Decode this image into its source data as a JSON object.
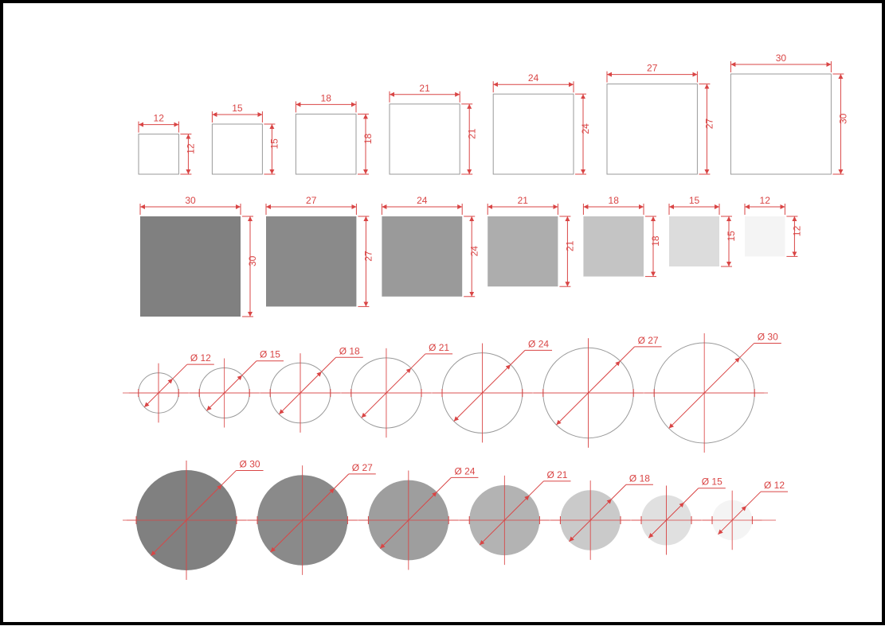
{
  "row1": {
    "description": "outlined squares ascending, dimension above and right",
    "squares": [
      {
        "size": 12
      },
      {
        "size": 15
      },
      {
        "size": 18
      },
      {
        "size": 21
      },
      {
        "size": 24
      },
      {
        "size": 27
      },
      {
        "size": 30
      }
    ]
  },
  "row2": {
    "description": "filled gray squares descending, dimension above and right",
    "squares": [
      {
        "size": 30,
        "fill": "#808080"
      },
      {
        "size": 27,
        "fill": "#8a8a8a"
      },
      {
        "size": 24,
        "fill": "#9a9a9a"
      },
      {
        "size": 21,
        "fill": "#adadad"
      },
      {
        "size": 18,
        "fill": "#c4c4c4"
      },
      {
        "size": 15,
        "fill": "#dcdcdc"
      },
      {
        "size": 12,
        "fill": "#f4f4f4"
      }
    ]
  },
  "row3": {
    "description": "outlined circles ascending with diameter leader",
    "circles": [
      {
        "dia": 12
      },
      {
        "dia": 15
      },
      {
        "dia": 18
      },
      {
        "dia": 21
      },
      {
        "dia": 24
      },
      {
        "dia": 27
      },
      {
        "dia": 30
      }
    ],
    "prefix": "Ø"
  },
  "row4": {
    "description": "filled gray circles descending with diameter leader",
    "circles": [
      {
        "dia": 30,
        "fill": "#808080"
      },
      {
        "dia": 27,
        "fill": "#8a8a8a"
      },
      {
        "dia": 24,
        "fill": "#9e9e9e"
      },
      {
        "dia": 21,
        "fill": "#b3b3b3"
      },
      {
        "dia": 18,
        "fill": "#cacaca"
      },
      {
        "dia": 15,
        "fill": "#e0e0e0"
      },
      {
        "dia": 12,
        "fill": "#f4f4f4"
      }
    ],
    "prefix": "Ø"
  },
  "colors": {
    "dim": "#d94545",
    "outline": "#9a9a9a"
  }
}
